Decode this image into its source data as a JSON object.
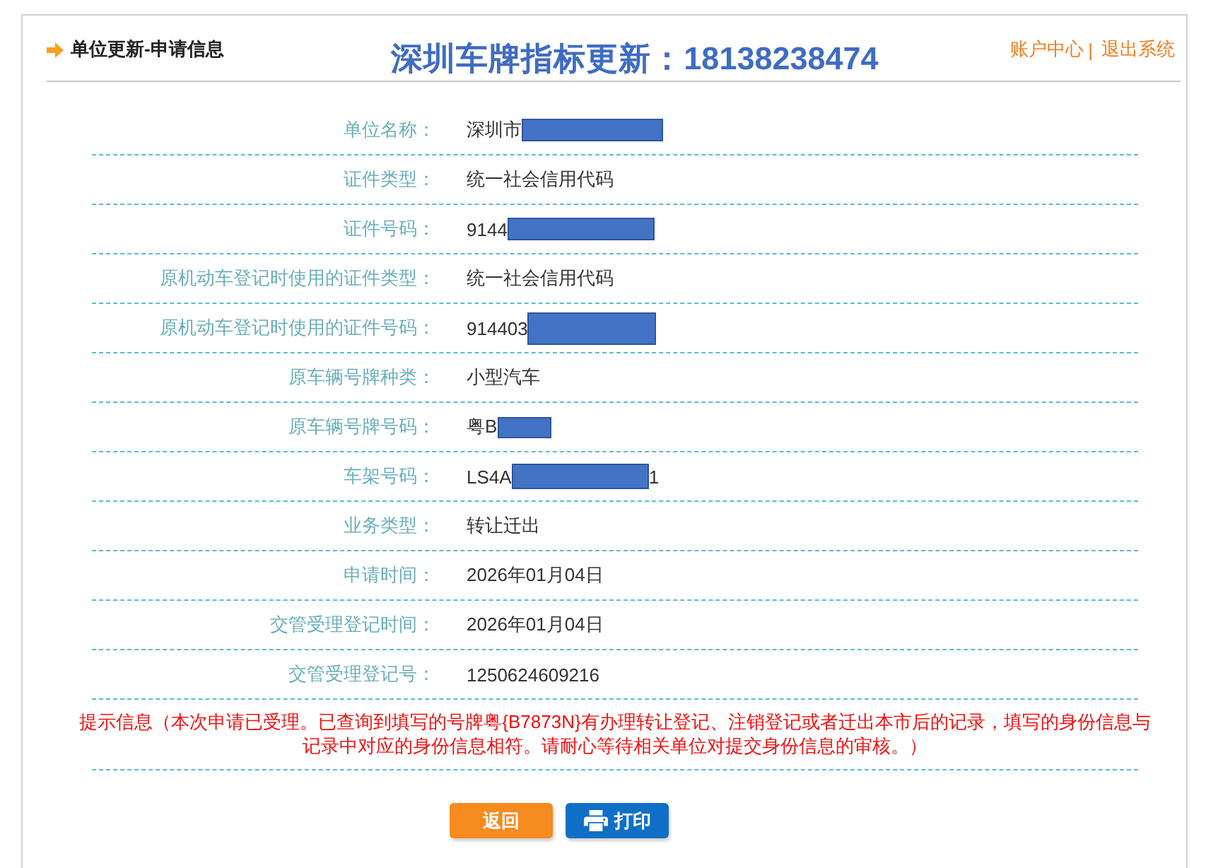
{
  "header": {
    "section_title": "单位更新-申请信息",
    "title": "深圳车牌指标更新：18138238474",
    "links": [
      {
        "label": "账户中心"
      },
      {
        "label": "退出系统"
      }
    ],
    "link_separator": "|"
  },
  "rows": [
    {
      "label": "单位名称：",
      "value": "深圳市",
      "redacted": true
    },
    {
      "label": "证件类型：",
      "value": "统一社会信用代码",
      "redacted": false
    },
    {
      "label": "证件号码：",
      "value": "9144",
      "redacted": true
    },
    {
      "label": "原机动车登记时使用的证件类型：",
      "value": "统一社会信用代码",
      "redacted": false
    },
    {
      "label": "原机动车登记时使用的证件号码：",
      "value": "914403",
      "redacted": true
    },
    {
      "label": "原车辆号牌种类：",
      "value": "小型汽车",
      "redacted": false
    },
    {
      "label": "原车辆号牌号码：",
      "value": "粤B",
      "redacted": true
    },
    {
      "label": "车架号码：",
      "value": "LS4A",
      "redacted": true,
      "value_end": "1"
    },
    {
      "label": "业务类型：",
      "value": "转让迁出",
      "redacted": false
    },
    {
      "label": "申请时间：",
      "value": "2026年01月04日",
      "redacted": false
    },
    {
      "label": "交管受理登记时间：",
      "value": "2026年01月04日",
      "redacted": false
    },
    {
      "label": "交管受理登记号：",
      "value": "1250624609216",
      "redacted": false
    }
  ],
  "notice": "提示信息（本次申请已受理。已查询到填写的号牌粤{B7873N}有办理转让登记、注销登记或者迁出本市后的记录，填写的身份信息与记录中对应的身份信息相符。请耐心等待相关单位对提交身份信息的审核。）",
  "buttons": [
    {
      "label": "返回",
      "kind": "back"
    },
    {
      "label": "打印",
      "kind": "print"
    }
  ]
}
